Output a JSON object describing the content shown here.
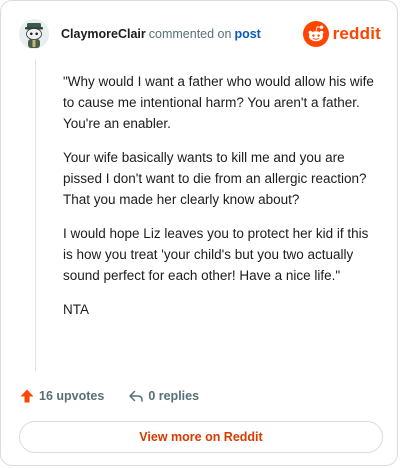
{
  "header": {
    "username": "ClaymoreClair",
    "commented_text": "commented on",
    "post_link": "post",
    "brand": "reddit"
  },
  "comment": {
    "paragraphs": [
      "\"Why would I want a father who would allow his wife to cause me intentional harm? You aren't a father. You're an enabler.",
      "Your wife basically wants to kill me and you are pissed I don't want to die from an allergic reaction? That you made her clearly know about?",
      "I would hope Liz leaves you to protect her kid if this is how you treat 'your child's but you two actually sound perfect for each other! Have a nice life.\"",
      "NTA"
    ]
  },
  "actions": {
    "upvotes": "16 upvotes",
    "replies": "0 replies"
  },
  "footer": {
    "view_more": "View more on Reddit"
  },
  "colors": {
    "brand": "#ff4500",
    "upvote": "#ff4500",
    "link": "#0a5ab8",
    "view_more_text": "#d93a00",
    "muted": "#576f76"
  },
  "icons": {
    "avatar": "snoo-avatar-icon",
    "brand": "reddit-snoo-icon",
    "upvote": "upvote-arrow-icon",
    "reply": "reply-arrow-icon"
  }
}
